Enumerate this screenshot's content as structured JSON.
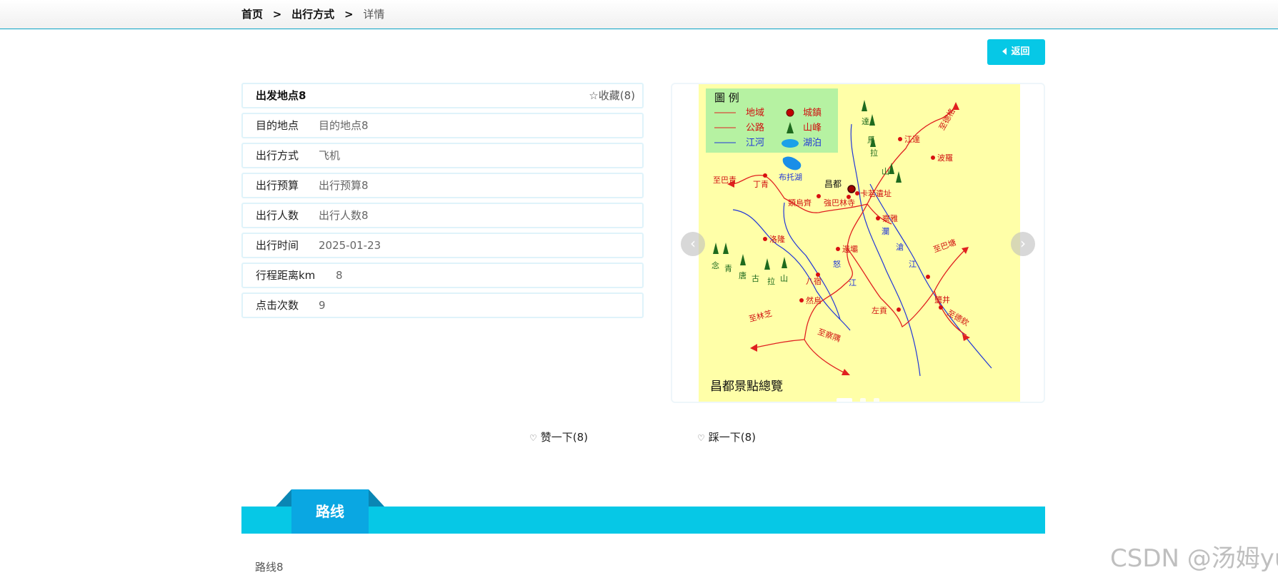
{
  "breadcrumb": {
    "home": "首页",
    "section": "出行方式",
    "current": "详情",
    "separator": ">"
  },
  "back_button": {
    "label": "返回"
  },
  "detail": {
    "title": "出发地点8",
    "favorite_label": "收藏(8)",
    "rows": [
      {
        "label": "目的地点",
        "value": "目的地点8"
      },
      {
        "label": "出行方式",
        "value": "飞机"
      },
      {
        "label": "出行预算",
        "value": "出行预算8"
      },
      {
        "label": "出行人数",
        "value": "出行人数8"
      },
      {
        "label": "出行时间",
        "value": "2025-01-23"
      },
      {
        "label": "行程距离km",
        "value": "8"
      },
      {
        "label": "点击次数",
        "value": "9"
      }
    ]
  },
  "carousel": {
    "prev_glyph": "‹",
    "next_glyph": "›",
    "slide_count": 3,
    "active_slide": 1,
    "map": {
      "title": "昌都景點總覽",
      "legend": {
        "heading": "圖 例",
        "items": [
          "地域",
          "城鎮",
          "公路",
          "山峰",
          "江河",
          "湖泊"
        ]
      },
      "cities": [
        "昌都",
        "江達",
        "波羅",
        "丁青",
        "類烏齊",
        "強巴林寺",
        "卡若遺址",
        "察雅",
        "洛隆",
        "邊壩",
        "八宿",
        "然烏",
        "左貢",
        "鹽井"
      ],
      "roads": [
        "至巴青",
        "至德格",
        "至巴塘",
        "至德欽",
        "至林芝",
        "至察隅"
      ],
      "lakes": [
        "布托湖"
      ],
      "rivers": [
        "瀾",
        "滄",
        "江",
        "怒",
        "江"
      ],
      "mountains": [
        "達",
        "馬",
        "拉",
        "山",
        "念",
        "青",
        "唐",
        "古",
        "拉",
        "山"
      ]
    }
  },
  "votes": {
    "like": {
      "icon": "♡",
      "label": "赞一下(8)"
    },
    "dislike": {
      "icon": "♡",
      "label": "踩一下(8)"
    }
  },
  "route": {
    "tab_label": "路线",
    "content": "路线8"
  },
  "watermark": "CSDN @汤姆yu",
  "colors": {
    "accent": "#06c8e6",
    "tab": "#0aa7e2",
    "map_bg": "#ffffa8",
    "legend_bg": "#b6f2a2",
    "road": "#e02020",
    "river": "#2036d8"
  }
}
